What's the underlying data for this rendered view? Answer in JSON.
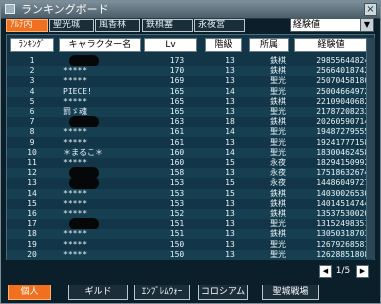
{
  "window": {
    "title": "ランキングボード",
    "close_label": "×"
  },
  "map_tabs": [
    {
      "label": "ｱﾙﾃ内",
      "active": true
    },
    {
      "label": "聖光城",
      "active": false
    },
    {
      "label": "風香林",
      "active": false
    },
    {
      "label": "鉄棋塞",
      "active": false
    },
    {
      "label": "永夜宮",
      "active": false
    }
  ],
  "sort_select": {
    "value": "経験値",
    "arrow": "▼"
  },
  "table": {
    "headers": [
      "ﾗﾝｷﾝｸﾞ",
      "キャラクター名",
      "Lv",
      "階級",
      "所属",
      "経験値"
    ],
    "rows": [
      {
        "rank": "1",
        "name": "",
        "lv": "173",
        "grade": "13",
        "guild": "鉄棋",
        "exp": "298556448242"
      },
      {
        "rank": "2",
        "name": "*****",
        "lv": "170",
        "grade": "13",
        "guild": "鉄棋",
        "exp": "256640187420"
      },
      {
        "rank": "3",
        "name": "*****",
        "lv": "169",
        "grade": "13",
        "guild": "聖光",
        "exp": "250704581808"
      },
      {
        "rank": "4",
        "name": "PIECE!",
        "lv": "165",
        "grade": "14",
        "guild": "聖光",
        "exp": "250046649721"
      },
      {
        "rank": "5",
        "name": "*****",
        "lv": "165",
        "grade": "13",
        "guild": "鉄棋",
        "exp": "221090406823"
      },
      {
        "rank": "6",
        "name": "罰ゞ魂",
        "lv": "165",
        "grade": "13",
        "guild": "聖光",
        "exp": "217872082332"
      },
      {
        "rank": "7",
        "name": "",
        "lv": "163",
        "grade": "18",
        "guild": "鉄棋",
        "exp": "202605907144"
      },
      {
        "rank": "8",
        "name": "*****",
        "lv": "161",
        "grade": "14",
        "guild": "聖光",
        "exp": "194872795558"
      },
      {
        "rank": "9",
        "name": "*****",
        "lv": "161",
        "grade": "13",
        "guild": "聖光",
        "exp": "192417771583"
      },
      {
        "rank": "10",
        "name": "＊まるこ＊",
        "lv": "160",
        "grade": "14",
        "guild": "聖光",
        "exp": "183004624584"
      },
      {
        "rank": "11",
        "name": "*****",
        "lv": "160",
        "grade": "15",
        "guild": "永夜",
        "exp": "182941509920"
      },
      {
        "rank": "12",
        "name": "",
        "lv": "158",
        "grade": "13",
        "guild": "永夜",
        "exp": "175186326744"
      },
      {
        "rank": "13",
        "name": "",
        "lv": "153",
        "grade": "15",
        "guild": "永夜",
        "exp": "144860497277"
      },
      {
        "rank": "14",
        "name": "*****",
        "lv": "153",
        "grade": "15",
        "guild": "鉄棋",
        "exp": "140300265307"
      },
      {
        "rank": "15",
        "name": "*****",
        "lv": "153",
        "grade": "13",
        "guild": "鉄棋",
        "exp": "140145147442"
      },
      {
        "rank": "16",
        "name": "*****",
        "lv": "152",
        "grade": "13",
        "guild": "鉄棋",
        "exp": "135375300204"
      },
      {
        "rank": "17",
        "name": "",
        "lv": "151",
        "grade": "13",
        "guild": "聖光",
        "exp": "131524983519"
      },
      {
        "rank": "18",
        "name": "*****",
        "lv": "151",
        "grade": "13",
        "guild": "鉄棋",
        "exp": "130503187031"
      },
      {
        "rank": "19",
        "name": "*****",
        "lv": "150",
        "grade": "13",
        "guild": "聖光",
        "exp": "126792685815"
      },
      {
        "rank": "20",
        "name": "*****",
        "lv": "150",
        "grade": "13",
        "guild": "聖光",
        "exp": "126288518082"
      }
    ]
  },
  "pager": {
    "text": "1/5",
    "prev": "◀",
    "next": "▶"
  },
  "bottom_tabs": [
    {
      "label": "個人",
      "active": true
    },
    {
      "label": "ギルド",
      "active": false
    },
    {
      "label": "ｴﾝﾌﾞﾚﾑｳｫｰ",
      "active": false
    },
    {
      "label": "コロシアム",
      "active": false
    },
    {
      "label": "聖城戦場",
      "active": false
    }
  ]
}
